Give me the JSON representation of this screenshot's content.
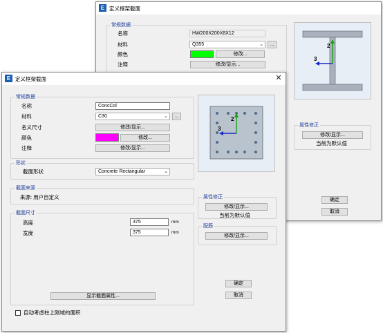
{
  "back_window": {
    "title": "定义框架截面",
    "general_group": "常规数据",
    "name_label": "名称",
    "name_value": "HW200X200X8X12",
    "material_label": "材料",
    "material_value": "Q355",
    "color_label": "颜色",
    "color_value": "#00ff00",
    "color_button": "修改...",
    "notes_label": "注释",
    "notes_button": "修改/显示...",
    "ellipsis": "...",
    "modifiers_group": "属性修正",
    "modifiers_button": "修改/显示...",
    "modifiers_status": "当前为默认值",
    "ok_button": "确定",
    "cancel_button": "取消",
    "axis_2": "2",
    "axis_3": "3"
  },
  "front_window": {
    "title": "定义框架截面",
    "close_glyph": "✕",
    "general_group": "常规数据",
    "name_label": "名称",
    "name_value": "ConcCol",
    "material_label": "材料",
    "material_value": "C30",
    "notional_label": "名义尺寸",
    "notional_button": "修改/显示...",
    "color_label": "颜色",
    "color_value": "#ff00ff",
    "color_button": "修改...",
    "notes_label": "注释",
    "notes_button": "修改/显示...",
    "ellipsis": "...",
    "shape_group": "形状",
    "shape_label": "截面形状",
    "shape_value": "Concrete Rectangular",
    "source_group": "截面来源",
    "source_text": "来源: 用户自定义",
    "dims_group": "截面尺寸",
    "depth_label": "高度",
    "depth_value": "375",
    "width_label": "宽度",
    "width_value": "375",
    "unit": "mm",
    "show_props_button": "显示截面属性...",
    "modifiers_group": "属性修正",
    "modifiers_button": "修改/显示...",
    "modifiers_status": "当前为默认值",
    "rebar_group": "配筋",
    "rebar_button": "修改/显示...",
    "ok_button": "确定",
    "cancel_button": "取消",
    "checkbox_label": "自动考虑柱上刚域的面积",
    "checkbox_checked": false,
    "axis_2": "2",
    "axis_3": "3"
  }
}
